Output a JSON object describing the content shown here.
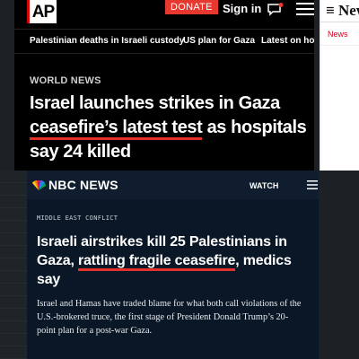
{
  "ap": {
    "logo_text": "AP",
    "donate_label": "DONATE",
    "signin_label": "Sign in",
    "nav_items": [
      "Palestinian deaths in Israeli custody",
      "US plan for Gaza",
      "Latest on ho"
    ],
    "section_label": "WORLD NEWS",
    "headline": {
      "part1": "Israel launches strikes in Gaza",
      "underlined": "ceasefire’s latest test",
      "part2": " as hospitals say 24 killed"
    },
    "accent_color": "#e3302a"
  },
  "newsweek": {
    "logo_text": "New",
    "tag_label": "News",
    "accent_color": "#d0021b"
  },
  "nbc": {
    "brand": "NBC NEWS",
    "watch_label": "WATCH",
    "section_label": "MIDDLE EAST CONFLICT",
    "headline": {
      "part1": "Israeli airstrikes kill 25 Palestinians in Gaza, ",
      "underlined": "rattling fragile ceasefire",
      "part2": ", medics say"
    },
    "body": "Israel and Hamas have traded blame for what both call violations of the U.S.-brokered truce, the first stage of President Donald Trump’s 20-point plan for a post-war Gaza.",
    "background_color": "#0a1726"
  },
  "icons": [
    "ap-logo",
    "chat-icon",
    "menu-icon",
    "peacock-icon",
    "nbc-menu-icon"
  ]
}
